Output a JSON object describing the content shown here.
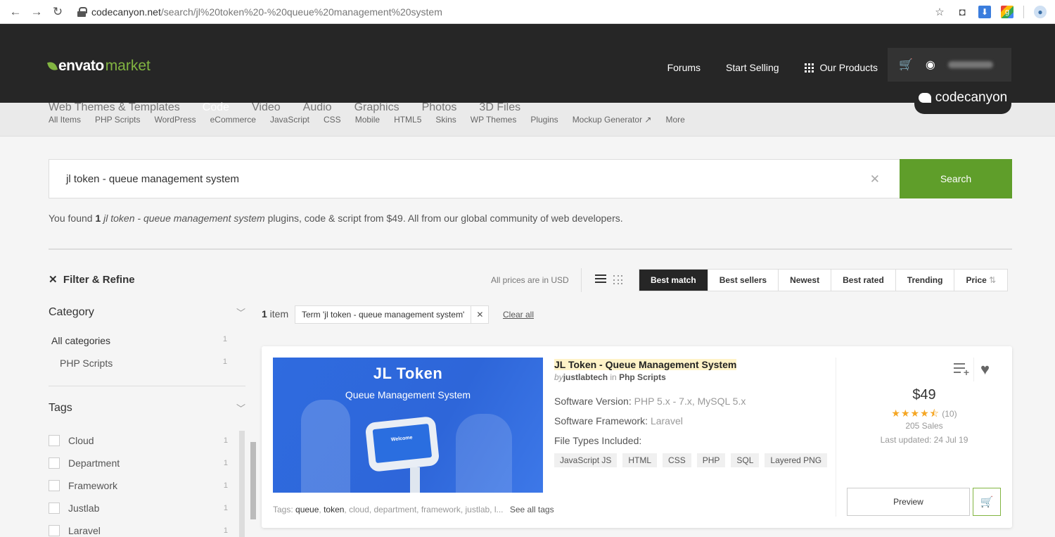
{
  "browser": {
    "url_host": "codecanyon.net",
    "url_path": "/search/jl%20token%20-%20queue%20management%20system"
  },
  "header": {
    "logo_envato": "envato",
    "logo_market": "market",
    "links": [
      "Forums",
      "Start Selling",
      "Our Products"
    ],
    "main_nav": [
      "Web Themes & Templates",
      "Code",
      "Video",
      "Audio",
      "Graphics",
      "Photos",
      "3D Files"
    ],
    "active_nav": "Code",
    "badge": "codecanyon"
  },
  "sub_nav": [
    "All Items",
    "PHP Scripts",
    "WordPress",
    "eCommerce",
    "JavaScript",
    "CSS",
    "Mobile",
    "HTML5",
    "Skins",
    "WP Themes",
    "Plugins",
    "Mockup Generator ↗",
    "More"
  ],
  "search": {
    "value": "jl token - queue management system",
    "button": "Search"
  },
  "found": {
    "prefix": "You found ",
    "count": "1",
    "term": "jl token - queue management system",
    "suffix": " plugins, code & script from $49. All from our global community of web developers."
  },
  "sidebar": {
    "filter_title": "Filter & Refine",
    "category_head": "Category",
    "categories": [
      {
        "label": "All categories",
        "count": "1"
      },
      {
        "label": "PHP Scripts",
        "count": "1"
      }
    ],
    "tags_head": "Tags",
    "tags": [
      {
        "label": "Cloud",
        "count": "1"
      },
      {
        "label": "Department",
        "count": "1"
      },
      {
        "label": "Framework",
        "count": "1"
      },
      {
        "label": "Justlab",
        "count": "1"
      },
      {
        "label": "Laravel",
        "count": "1"
      }
    ]
  },
  "results": {
    "prices_note": "All prices are in USD",
    "sort": [
      "Best match",
      "Best sellers",
      "Newest",
      "Best rated",
      "Trending",
      "Price"
    ],
    "item_count": "1",
    "item_word": " item",
    "chip": "Term 'jl token - queue management system'",
    "clear_all": "Clear all"
  },
  "item": {
    "thumb_title": "JL Token",
    "thumb_subtitle": "Queue Management System",
    "thumb_screen": "Welcome",
    "title": "JL Token - Queue Management System",
    "by": "by",
    "author": "justlabtech",
    "in": " in ",
    "category": "Php Scripts",
    "software_version_label": "Software Version: ",
    "software_version": "PHP 5.x - 7.x, MySQL 5.x",
    "framework_label": "Software Framework: ",
    "framework": "Laravel",
    "file_types_label": "File Types Included:",
    "file_types": [
      "JavaScript JS",
      "HTML",
      "CSS",
      "PHP",
      "SQL",
      "Layered PNG"
    ],
    "tags_label": "Tags: ",
    "tags_bold": [
      "queue",
      "token"
    ],
    "tags_rest": ", cloud, department, framework, justlab, l...",
    "see_all": "See all tags",
    "price": "$49",
    "rating": 4.5,
    "rating_count": "(10)",
    "sales": "205 Sales",
    "updated": "Last updated: 24 Jul 19",
    "preview": "Preview"
  }
}
